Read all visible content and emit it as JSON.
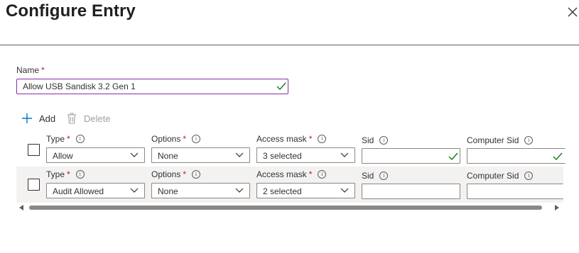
{
  "dialog": {
    "title": "Configure Entry",
    "close_icon": "close-icon"
  },
  "name_field": {
    "label": "Name",
    "required_mark": "*",
    "value": "Allow USB Sandisk 3.2 Gen 1",
    "valid_icon": "checkmark-icon"
  },
  "toolbar": {
    "add_label": "Add",
    "add_icon": "plus-icon",
    "delete_label": "Delete",
    "delete_icon": "trash-icon"
  },
  "columns": {
    "type": "Type",
    "options": "Options",
    "access_mask": "Access mask",
    "sid": "Sid",
    "computer_sid": "Computer Sid",
    "required_mark": "*",
    "info_icon": "info-icon"
  },
  "rows": [
    {
      "type": "Allow",
      "options": "None",
      "access_mask": "3 selected",
      "sid": "",
      "computer_sid": "",
      "sid_valid": true,
      "computer_sid_valid": true
    },
    {
      "type": "Audit Allowed",
      "options": "None",
      "access_mask": "2 selected",
      "sid": "",
      "computer_sid": ""
    }
  ],
  "colors": {
    "accent_border": "#8a2da5",
    "valid_check": "#107c10",
    "required": "#a4262c",
    "row_highlight": "#f3f2f1",
    "add_icon": "#0078d4"
  }
}
